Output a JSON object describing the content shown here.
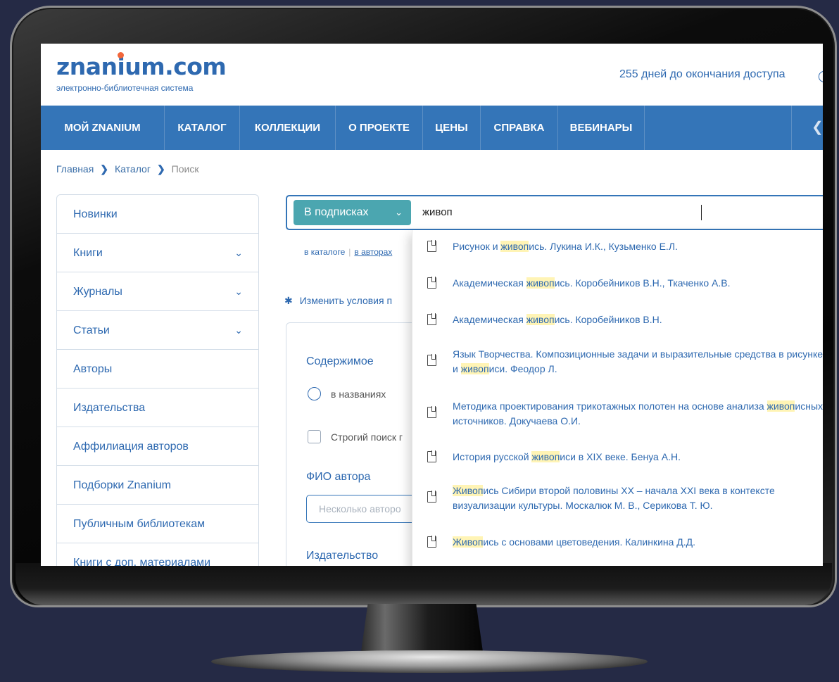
{
  "header": {
    "logo_name_part1": "znanium",
    "logo_name_part2": ".com",
    "logo_tagline": "электронно-библиотечная система",
    "access_text": "255 дней до окончания доступа"
  },
  "nav": {
    "items": [
      "МОЙ ZNANIUM",
      "КАТАЛОГ",
      "КОЛЛЕКЦИИ",
      "О ПРОЕКТЕ",
      "ЦЕНЫ",
      "СПРАВКА",
      "ВЕБИНАРЫ"
    ]
  },
  "breadcrumb": {
    "items": [
      "Главная",
      "Каталог",
      "Поиск"
    ],
    "separator": "❯"
  },
  "sidebar": {
    "items": [
      {
        "label": "Новинки",
        "expandable": false
      },
      {
        "label": "Книги",
        "expandable": true
      },
      {
        "label": "Журналы",
        "expandable": true
      },
      {
        "label": "Статьи",
        "expandable": true
      },
      {
        "label": "Авторы",
        "expandable": false
      },
      {
        "label": "Издательства",
        "expandable": false
      },
      {
        "label": "Аффилиация авторов",
        "expandable": false
      },
      {
        "label": "Подборки Znanium",
        "expandable": false
      },
      {
        "label": "Публичным библиотекам",
        "expandable": false
      },
      {
        "label": "Книги с доп. материалами",
        "expandable": false
      }
    ],
    "chevron": "⌄"
  },
  "search": {
    "scope_label": "В подписках",
    "query": "живоп",
    "links": [
      "в каталоге",
      "в авторах"
    ],
    "change_conditions": "Изменить условия п"
  },
  "filters": {
    "content_heading": "Содержимое",
    "radio_label": "в названиях",
    "strict_label": "Строгий поиск г",
    "author_heading": "ФИО автора",
    "author_placeholder": "Несколько авторо",
    "publisher_heading": "Издательство"
  },
  "suggestions": [
    {
      "before": "Рисунок и ",
      "match": "живоп",
      "after": "ись. Лукина И.К., Кузьменко Е.Л."
    },
    {
      "before": "Академическая ",
      "match": "живоп",
      "after": "ись. Коробейников В.Н., Ткаченко А.В."
    },
    {
      "before": "Академическая ",
      "match": "живоп",
      "after": "ись. Коробейников В.Н."
    },
    {
      "before": "Язык Творчества. Композиционные задачи и выразительные средства в рисунке и ",
      "match": "живоп",
      "after": "иси. Феодор Л."
    },
    {
      "before": "Методика проектирования трикотажных полотен на основе анализа ",
      "match": "живоп",
      "after": "исных источников. Докучаева О.И."
    },
    {
      "before": "История русской ",
      "match": "живоп",
      "after": "иси в XIX веке. Бенуа А.Н."
    },
    {
      "before": "",
      "match": "Живоп",
      "after": "ись Сибири второй половины XX – начала XXI века в контексте визуализации культуры. Москалюк М. В., Серикова Т. Ю."
    },
    {
      "before": "",
      "match": "Живоп",
      "after": "ись с основами цветоведения. Калинкина Д.Д."
    }
  ],
  "colors": {
    "brand_blue": "#2e69b0",
    "nav_blue": "#3475b8",
    "teal_button": "#4ba6b0",
    "accent_orange": "#f2663a",
    "highlight_yellow": "#fff4b5",
    "page_background": "#252a45"
  },
  "icons": {
    "gear": "gear-icon",
    "book": "book-icon",
    "chevron": "chevron-down-icon",
    "nav_arrow": "chevron-left-icon"
  }
}
